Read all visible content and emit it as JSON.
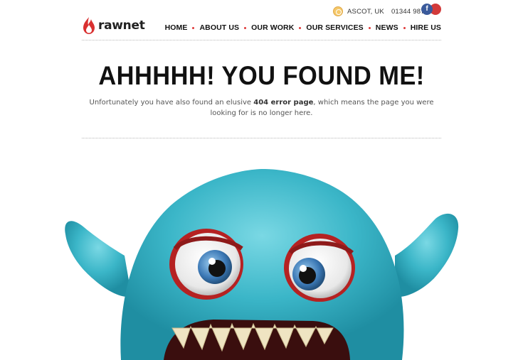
{
  "brand": {
    "name": "rawnet"
  },
  "contact": {
    "location": "ASCOT, UK",
    "phone": "01344 987 984"
  },
  "social": {
    "facebook_label": "f"
  },
  "nav": {
    "items": [
      {
        "label": "HOME"
      },
      {
        "label": "ABOUT US"
      },
      {
        "label": "OUR WORK"
      },
      {
        "label": "OUR SERVICES"
      },
      {
        "label": "NEWS"
      },
      {
        "label": "HIRE US"
      }
    ]
  },
  "hero": {
    "title": "AHHHHH! YOU FOUND ME!",
    "desc_before": "Unfortunately you have also found an elusive ",
    "desc_bold": "404 error page",
    "desc_after": ", which means the page you were looking for is no longer here."
  },
  "colors": {
    "accent": "#e03a3a",
    "monster_fur": "#3bb6c8",
    "facebook": "#3a5a9b"
  }
}
